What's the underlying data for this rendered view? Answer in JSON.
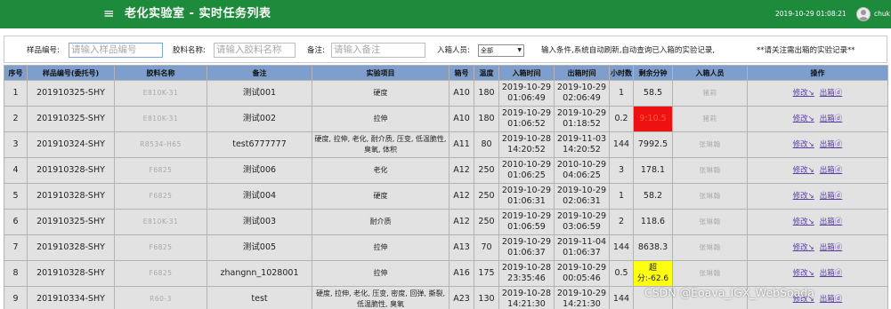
{
  "header": {
    "menu_icon": "≡",
    "title": "老化实验室 - 实时任务列表",
    "clock": "2019-10-29 01:08:21",
    "username": "chuk"
  },
  "filters": {
    "sample_label": "样品编号:",
    "sample_placeholder": "请输入样品编号",
    "material_label": "胶料名称:",
    "material_placeholder": "请输入胶料名称",
    "remark_label": "备注:",
    "remark_placeholder": "请输入备注",
    "person_label": "入箱人员:",
    "person_selected": "全部",
    "hint": "输入条件,系统自动刷新,自动查询已入箱的实验记录,",
    "notice": "**请关注需出箱的实验记录**"
  },
  "table": {
    "columns": [
      "序号",
      "样品编号(委托号)",
      "胶料名称",
      "备注",
      "实验项目",
      "箱号",
      "温度",
      "入箱时间",
      "出箱时间",
      "小时数",
      "剩余分钟",
      "入箱人员",
      "操作"
    ],
    "rows": [
      {
        "no": "1",
        "sample": "201910325-SHY",
        "material": "E810K-31",
        "remark": "测试001",
        "test": "硬度",
        "box": "A10",
        "temp": "180",
        "in_date": "2019-10-29",
        "in_time": "01:06:49",
        "out_date": "2019-10-29",
        "out_time": "02:06:49",
        "hours": "1",
        "remain": "58.5",
        "person": "猪莉",
        "edit": "修改↘",
        "out": "出箱ⓓ"
      },
      {
        "no": "2",
        "sample": "201910325-SHY",
        "material": "E810K-31",
        "remark": "测试002",
        "test": "拉伸",
        "box": "A10",
        "temp": "180",
        "in_date": "2019-10-29",
        "in_time": "01:06:52",
        "out_date": "2019-10-29",
        "out_time": "01:18:52",
        "hours": "0.2",
        "remain": "9:10.5",
        "person": "猪莉",
        "edit": "修改↘",
        "out": "出箱ⓓ"
      },
      {
        "no": "3",
        "sample": "201910324-SHY",
        "material": "R8534-H65",
        "remark": "test6777777",
        "test": "硬度, 拉伸, 老化, 耐介质, 压变, 低温脆性, 臭氧, 体积",
        "box": "A11",
        "temp": "80",
        "in_date": "2019-10-28",
        "in_time": "14:20:52",
        "out_date": "2019-11-03",
        "out_time": "14:20:52",
        "hours": "144",
        "remain": "7992.5",
        "person": "张琳翰",
        "edit": "修改↘",
        "out": "出箱ⓓ"
      },
      {
        "no": "4",
        "sample": "201910328-SHY",
        "material": "F6825",
        "remark": "测试006",
        "test": "老化",
        "box": "A12",
        "temp": "250",
        "in_date": "2010-10-29",
        "in_time": "01:06:25",
        "out_date": "2010-10-29",
        "out_time": "04:06:25",
        "hours": "3",
        "remain": "178.1",
        "person": "张琳翰",
        "edit": "修改↘",
        "out": "出箱ⓓ"
      },
      {
        "no": "5",
        "sample": "201910328-SHY",
        "material": "F6825",
        "remark": "测试004",
        "test": "硬度",
        "box": "A12",
        "temp": "250",
        "in_date": "2019-10-29",
        "in_time": "01:06:31",
        "out_date": "2019-10-29",
        "out_time": "02:06:31",
        "hours": "1",
        "remain": "58.2",
        "person": "张琳翰",
        "edit": "修改↘",
        "out": "出箱ⓓ"
      },
      {
        "no": "6",
        "sample": "201910325-SHY",
        "material": "E810K-31",
        "remark": "测试003",
        "test": "耐介质",
        "box": "A12",
        "temp": "250",
        "in_date": "2019-10-29",
        "in_time": "01:06:59",
        "out_date": "2019-10-29",
        "out_time": "03:06:59",
        "hours": "2",
        "remain": "118.6",
        "person": "张琳翰",
        "edit": "修改↘",
        "out": "出箱ⓓ"
      },
      {
        "no": "7",
        "sample": "201910328-SHY",
        "material": "F6825",
        "remark": "测试005",
        "test": "拉伸",
        "box": "A13",
        "temp": "70",
        "in_date": "2019-10-29",
        "in_time": "01:06:37",
        "out_date": "2019-11-04",
        "out_time": "01:06:37",
        "hours": "144",
        "remain": "8638.3",
        "person": "张琳翰",
        "edit": "修改↘",
        "out": "出箱ⓓ"
      },
      {
        "no": "8",
        "sample": "201910328-SHY",
        "material": "F6825",
        "remark": "zhangnn_1028001",
        "test": "拉伸",
        "box": "A16",
        "temp": "175",
        "in_date": "2019-10-28",
        "in_time": "23:35:46",
        "out_date": "2019-10-29",
        "out_time": "00:05:46",
        "hours": "0.5",
        "remain": "超分:-62.6",
        "person": "张琳翰",
        "edit": "修改↘",
        "out": "出箱ⓓ"
      },
      {
        "no": "9",
        "sample": "201910334-SHY",
        "material": "R60-3",
        "remark": "test",
        "test": "硬度, 拉伸, 老化, 压变, 密度, 回弹, 撕裂, 低温脆性, 臭氧",
        "box": "A23",
        "temp": "130",
        "in_date": "2019-10-28",
        "in_time": "14:21:30",
        "out_date": "2019-10-29",
        "out_time": "14:21:30",
        "hours": "144",
        "remain": "",
        "person": "",
        "edit": "修改↘",
        "out": "出箱ⓓ"
      }
    ]
  },
  "watermark": "CSDN @Eoava_IGX_WebSoada",
  "colors": {
    "topbar": "#1e8b3c",
    "header_row": "#7e9fce",
    "row_bg": "#e2e2e2",
    "overdue": "#ee1111",
    "warning": "#ffff10",
    "link": "#5b3ea6"
  }
}
